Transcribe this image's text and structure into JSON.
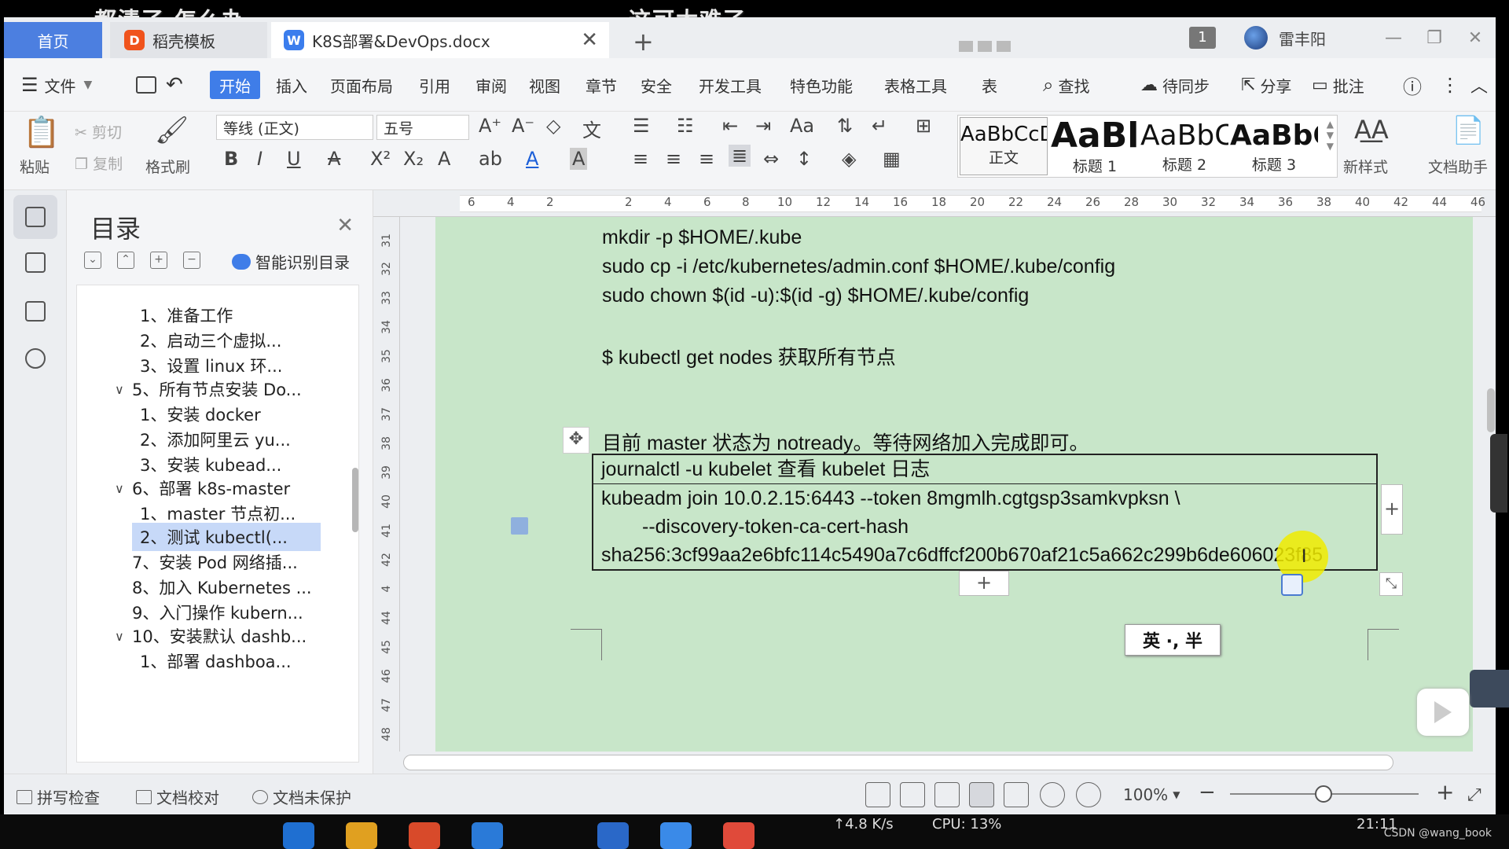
{
  "overlays": {
    "left_comment": "都清了 怎么办",
    "right_comment": "这可太难了"
  },
  "titlebar": {
    "home_tab": "首页",
    "templates_tab": "稻壳模板",
    "templates_logo": "D",
    "doc_tab": "K8S部署&DevOps.docx",
    "doc_logo": "W",
    "badge": "1",
    "user_name": "雷丰阳"
  },
  "menu": {
    "file": "文件",
    "items": [
      "开始",
      "插入",
      "页面布局",
      "引用",
      "审阅",
      "视图",
      "章节",
      "安全",
      "开发工具",
      "特色功能",
      "表格工具",
      "表"
    ],
    "search": "查找",
    "sync": "待同步",
    "share": "分享",
    "review": "批注"
  },
  "ribbon": {
    "paste": "粘贴",
    "cut": "剪切",
    "copy": "复制",
    "format_painter": "格式刷",
    "font_name": "等线 (正文)",
    "font_size": "五号",
    "styles": [
      {
        "sample": "AaBbCcDc",
        "label": "正文"
      },
      {
        "sample": "AaBl",
        "label": "标题 1"
      },
      {
        "sample": "AaBbC",
        "label": "标题 2"
      },
      {
        "sample": "AaBbC",
        "label": "标题 3"
      }
    ],
    "new_style": "新样式",
    "doc_assistant": "文档助手"
  },
  "toc": {
    "title": "目录",
    "ai_label": "智能识别目录",
    "items": [
      {
        "text": "1、准备工作",
        "level": 2,
        "expanded": null
      },
      {
        "text": "2、启动三个虚拟...",
        "level": 2,
        "expanded": null
      },
      {
        "text": "3、设置 linux 环...",
        "level": 2,
        "expanded": null
      },
      {
        "text": "5、所有节点安装 Do...",
        "level": 1,
        "expanded": true
      },
      {
        "text": "1、安装 docker",
        "level": 2,
        "expanded": null
      },
      {
        "text": "2、添加阿里云 yu...",
        "level": 2,
        "expanded": null
      },
      {
        "text": "3、安装 kubead...",
        "level": 2,
        "expanded": null
      },
      {
        "text": "6、部署 k8s-master",
        "level": 1,
        "expanded": true
      },
      {
        "text": "1、master 节点初...",
        "level": 2,
        "expanded": null
      },
      {
        "text": "2、测试 kubectl(...",
        "level": 2,
        "expanded": null,
        "selected": true
      },
      {
        "text": "7、安装 Pod 网络插...",
        "level": 1,
        "expanded": null
      },
      {
        "text": "8、加入 Kubernetes ...",
        "level": 1,
        "expanded": null
      },
      {
        "text": "9、入门操作 kubern...",
        "level": 1,
        "expanded": null
      },
      {
        "text": "10、安装默认 dashb...",
        "level": 1,
        "expanded": true
      },
      {
        "text": "1、部署 dashboa...",
        "level": 2,
        "expanded": null
      }
    ]
  },
  "ruler": {
    "h_ticks": [
      "6",
      "4",
      "2",
      "2",
      "4",
      "6",
      "8",
      "10",
      "12",
      "14",
      "16",
      "18",
      "20",
      "22",
      "24",
      "26",
      "28",
      "30",
      "32",
      "34",
      "36",
      "38",
      "40",
      "42",
      "44",
      "46"
    ],
    "v_ticks": [
      "31",
      "32",
      "33",
      "34",
      "35",
      "36",
      "37",
      "38",
      "39",
      "40",
      "41",
      "42",
      "4",
      "44",
      "45",
      "46",
      "47",
      "48"
    ]
  },
  "document": {
    "lines": [
      "mkdir -p $HOME/.kube",
      "sudo cp -i /etc/kubernetes/admin.conf $HOME/.kube/config",
      "sudo chown $(id -u):$(id -g) $HOME/.kube/config",
      "$ kubectl get nodes  获取所有节点",
      "目前 master 状态为 notready。等待网络加入完成即可。"
    ],
    "table_row1": "journalctl -u kubelet  查看 kubelet 日志",
    "table_row2": [
      "kubeadm join 10.0.2.15:6443 --token 8mgmlh.cgtgsp3samkvpksn \\",
      "--discovery-token-ca-cert-hash",
      "sha256:3cf99aa2e6bfc114c5490a7c6dffcf200b670af21c5a662c299b6de606023f85"
    ],
    "ime": "英 ·, 半"
  },
  "statusbar": {
    "spell": "拼写检查",
    "proof": "文档校对",
    "protect": "文档未保护",
    "zoom": "100%"
  },
  "taskbar": {
    "net": "↑4.8 K/s",
    "cpu": "CPU: 13%",
    "clock": "21:11",
    "watermark": "CSDN @wang_book"
  },
  "colors": {
    "accent": "#3f7de8",
    "page_bg": "#c8e6c9",
    "highlight": "#f0eb00"
  }
}
